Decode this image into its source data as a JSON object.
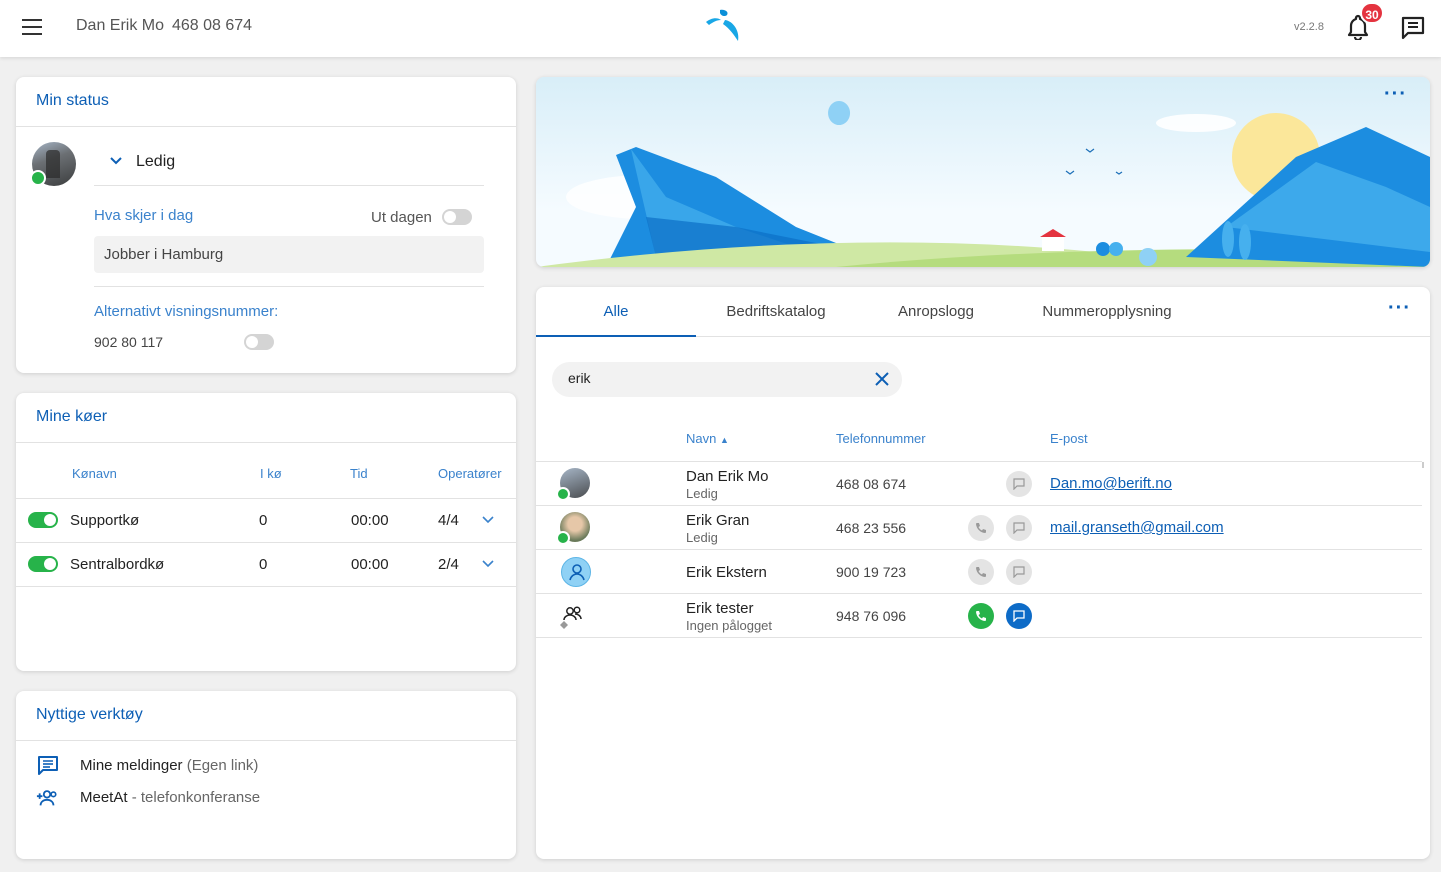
{
  "header": {
    "user_name": "Dan Erik Mo",
    "user_number": "468 08 674",
    "version": "v2.2.8",
    "notification_count": "30"
  },
  "status": {
    "title": "Min status",
    "current_status": "Ledig",
    "activity_label": "Hva skjer i dag",
    "out_today_label": "Ut dagen",
    "activity_value": "Jobber i Hamburg",
    "alt_number_label": "Alternativt visningsnummer:",
    "alt_number": "902 80 117"
  },
  "queues": {
    "title": "Mine køer",
    "headers": [
      "Kønavn",
      "I kø",
      "Tid",
      "Operatører"
    ],
    "rows": [
      {
        "name": "Supportkø",
        "in_queue": "0",
        "time": "00:00",
        "operators": "4/4",
        "enabled": true
      },
      {
        "name": "Sentralbordkø",
        "in_queue": "0",
        "time": "00:00",
        "operators": "2/4",
        "enabled": true
      }
    ]
  },
  "tools": {
    "title": "Nyttige verktøy",
    "items": [
      {
        "label": "Mine meldinger",
        "suffix": " (Egen link)",
        "icon": "message-icon"
      },
      {
        "label": "MeetAt",
        "suffix": " - telefonkonferanse",
        "icon": "group-add-icon"
      }
    ]
  },
  "contacts": {
    "tabs": [
      "Alle",
      "Bedriftskatalog",
      "Anropslogg",
      "Nummeropplysning"
    ],
    "active_tab": "Alle",
    "search_value": "erik",
    "headers": {
      "name": "Navn",
      "phone": "Telefonnummer",
      "email": "E-post"
    },
    "rows": [
      {
        "name": "Dan Erik Mo",
        "status": "Ledig",
        "phone": "468 08 674",
        "email": "Dan.mo@berift.no"
      },
      {
        "name": "Erik Gran",
        "status": "Ledig",
        "phone": "468 23 556",
        "email": "mail.granseth@gmail.com"
      },
      {
        "name": "Erik Ekstern",
        "status": "",
        "phone": "900 19 723",
        "email": ""
      },
      {
        "name": "Erik tester",
        "status": "Ingen pålogget",
        "phone": "948 76 096",
        "email": ""
      }
    ]
  },
  "colors": {
    "brand": "#0d5fb5",
    "online": "#27b34a",
    "badge": "#e4333f"
  }
}
